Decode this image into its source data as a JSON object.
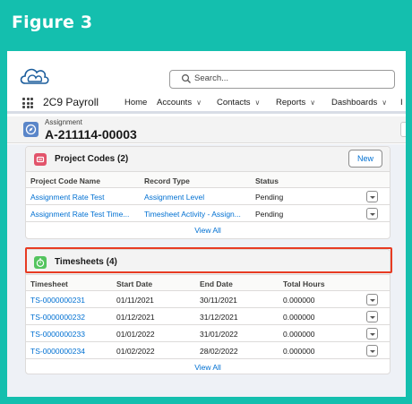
{
  "figure": {
    "title": "Figure 3"
  },
  "search": {
    "placeholder": "Search..."
  },
  "nav": {
    "app_name": "2C9 Payroll",
    "items": [
      {
        "label": "Home",
        "has_menu": false
      },
      {
        "label": "Accounts",
        "has_menu": true
      },
      {
        "label": "Contacts",
        "has_menu": true
      },
      {
        "label": "Reports",
        "has_menu": true
      },
      {
        "label": "Dashboards",
        "has_menu": true
      }
    ],
    "overflow_item": "I"
  },
  "record": {
    "type_label": "Assignment",
    "name": "A-211114-00003"
  },
  "project_codes": {
    "title": "Project Codes (2)",
    "new_label": "New",
    "icon_color": "#e2546b",
    "columns": [
      "Project Code Name",
      "Record Type",
      "Status"
    ],
    "rows": [
      {
        "name": "Assignment Rate Test",
        "record_type": "Assignment Level",
        "status": "Pending"
      },
      {
        "name": "Assignment Rate Test Time...",
        "record_type": "Timesheet Activity - Assign...",
        "status": "Pending"
      }
    ],
    "view_all": "View All"
  },
  "timesheets": {
    "title": "Timesheets (4)",
    "icon_color": "#54c45e",
    "columns": [
      "Timesheet",
      "Start Date",
      "End Date",
      "Total Hours"
    ],
    "rows": [
      {
        "id": "TS-0000000231",
        "start": "01/11/2021",
        "end": "30/11/2021",
        "hours": "0.000000"
      },
      {
        "id": "TS-0000000232",
        "start": "01/12/2021",
        "end": "31/12/2021",
        "hours": "0.000000"
      },
      {
        "id": "TS-0000000233",
        "start": "01/01/2022",
        "end": "31/01/2022",
        "hours": "0.000000"
      },
      {
        "id": "TS-0000000234",
        "start": "01/02/2022",
        "end": "28/02/2022",
        "hours": "0.000000"
      }
    ],
    "view_all": "View All"
  },
  "colors": {
    "frame": "#14bfae",
    "highlight": "#e73b23",
    "link": "#0070d2"
  }
}
